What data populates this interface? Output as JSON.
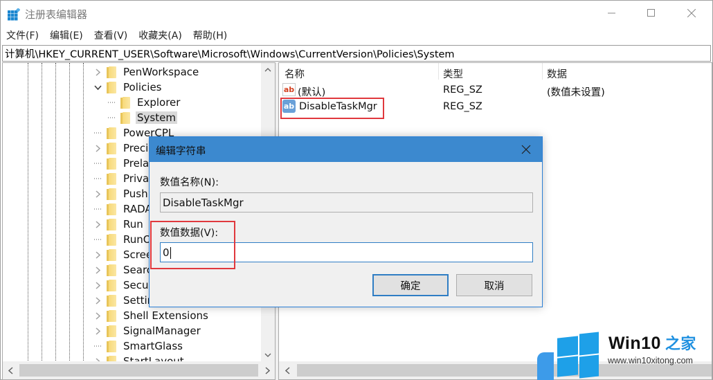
{
  "window": {
    "title": "注册表编辑器",
    "controls": {
      "minimize": "—",
      "maximize": "☐",
      "close": "✕"
    }
  },
  "menu": [
    "文件(F)",
    "编辑(E)",
    "查看(V)",
    "收藏夹(A)",
    "帮助(H)"
  ],
  "address": "计算机\\HKEY_CURRENT_USER\\Software\\Microsoft\\Windows\\CurrentVersion\\Policies\\System",
  "tree": {
    "items": [
      {
        "label": "PenWorkspace",
        "level": 0,
        "expander": "collapsed"
      },
      {
        "label": "Policies",
        "level": 0,
        "expander": "expanded"
      },
      {
        "label": "Explorer",
        "level": 1,
        "expander": "none"
      },
      {
        "label": "System",
        "level": 1,
        "expander": "none",
        "selected": true
      },
      {
        "label": "PowerCPL",
        "level": 0,
        "expander": "none"
      },
      {
        "label": "Precis",
        "level": 0,
        "expander": "collapsed"
      },
      {
        "label": "Prelau",
        "level": 0,
        "expander": "none"
      },
      {
        "label": "Privac",
        "level": 0,
        "expander": "none"
      },
      {
        "label": "PushN",
        "level": 0,
        "expander": "collapsed"
      },
      {
        "label": "RADA",
        "level": 0,
        "expander": "none"
      },
      {
        "label": "Run",
        "level": 0,
        "expander": "collapsed"
      },
      {
        "label": "RunOr",
        "level": 0,
        "expander": "none"
      },
      {
        "label": "Scree",
        "level": 0,
        "expander": "collapsed"
      },
      {
        "label": "Search",
        "level": 0,
        "expander": "collapsed"
      },
      {
        "label": "Securi",
        "level": 0,
        "expander": "collapsed"
      },
      {
        "label": "Settin",
        "level": 0,
        "expander": "collapsed"
      },
      {
        "label": "Shell Extensions",
        "level": 0,
        "expander": "collapsed"
      },
      {
        "label": "SignalManager",
        "level": 0,
        "expander": "collapsed"
      },
      {
        "label": "SmartGlass",
        "level": 0,
        "expander": "none"
      },
      {
        "label": "StartLayout",
        "level": 0,
        "expander": "collapsed"
      }
    ]
  },
  "list": {
    "columns": [
      "名称",
      "类型",
      "数据"
    ],
    "rows": [
      {
        "name": "(默认)",
        "type": "REG_SZ",
        "data": "(数值未设置)",
        "icon": "ab"
      },
      {
        "name": "DisableTaskMgr",
        "type": "REG_SZ",
        "data": "",
        "icon": "ab"
      }
    ]
  },
  "dialog": {
    "title": "编辑字符串",
    "name_label": "数值名称(N):",
    "name_value": "DisableTaskMgr",
    "data_label": "数值数据(V):",
    "data_value": "0",
    "ok_label": "确定",
    "cancel_label": "取消"
  },
  "watermark": {
    "brand": "Win10",
    "brand_cn": "之家",
    "url": "www.win10xitong.com"
  },
  "colors": {
    "dialog_title": "#3c89cf",
    "highlight": "#e0383d",
    "focus_border": "#2f7dc4"
  }
}
